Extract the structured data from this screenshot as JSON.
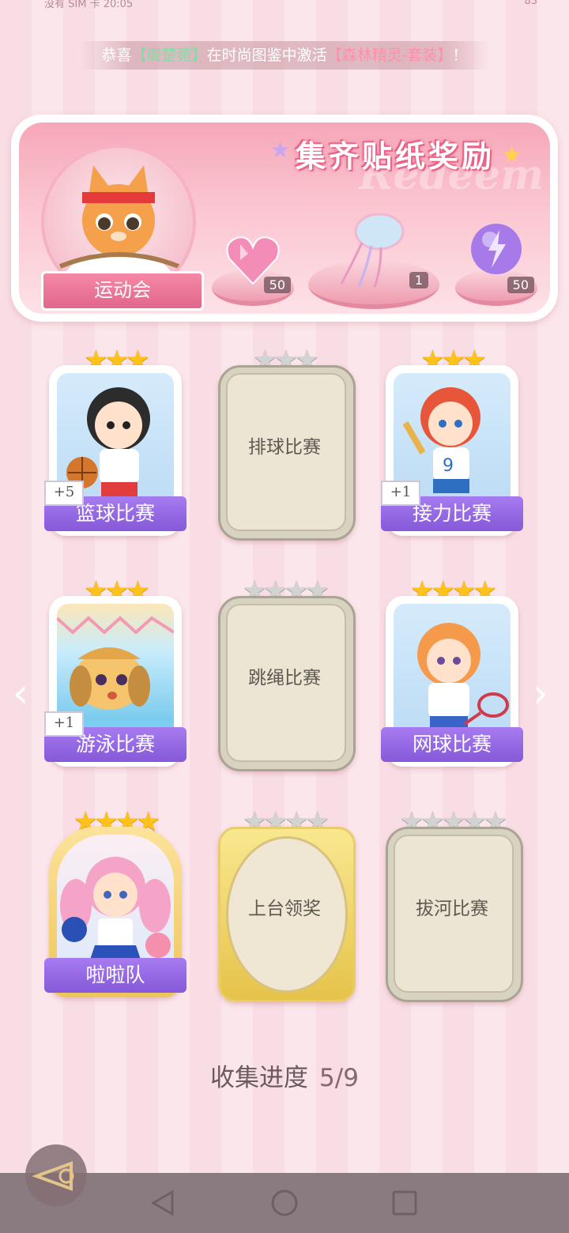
{
  "status_bar": {
    "left_text": "没有 SIM 卡 20:05",
    "right_text": "83"
  },
  "ticker": {
    "prefix": "恭喜",
    "player": "【周楚菀】",
    "middle": "在时尚图鉴中激活",
    "item": "【森林精灵-套装】",
    "suffix": "！"
  },
  "banner": {
    "title": "集齐贴纸奖励",
    "watermark": "Redeem",
    "event_label": "运动会",
    "rewards": [
      {
        "icon": "pink-heart-gem-icon",
        "count": "50"
      },
      {
        "icon": "jellyfish-ornament-icon",
        "count": "1"
      },
      {
        "icon": "purple-lightning-orb-icon",
        "count": "50"
      }
    ]
  },
  "cards": [
    {
      "title": "篮球比赛",
      "stars": 3,
      "state": "unlocked",
      "bonus": "+5",
      "art": "girl-basketball"
    },
    {
      "title": "排球比赛",
      "stars": 3,
      "state": "locked"
    },
    {
      "title": "接力比赛",
      "stars": 3,
      "state": "unlocked",
      "bonus": "+1",
      "art": "girl-relay"
    },
    {
      "title": "游泳比赛",
      "stars": 3,
      "state": "unlocked",
      "bonus": "+1",
      "art": "puppy-swim"
    },
    {
      "title": "跳绳比赛",
      "stars": 4,
      "state": "locked"
    },
    {
      "title": "网球比赛",
      "stars": 4,
      "state": "unlocked",
      "art": "girl-tennis"
    },
    {
      "title": "啦啦队",
      "stars": 4,
      "state": "unlocked-gold",
      "art": "girl-cheer"
    },
    {
      "title": "上台领奖",
      "stars": 4,
      "state": "locked-gold"
    },
    {
      "title": "拔河比赛",
      "stars": 5,
      "state": "locked"
    }
  ],
  "progress": {
    "label": "收集进度",
    "value": "5/9"
  },
  "colors": {
    "label_purple": "#8f63e0",
    "gold_star": "#ffc21a",
    "grey_star": "#d3d3d3",
    "banner_pink": "#f6a7b8"
  }
}
